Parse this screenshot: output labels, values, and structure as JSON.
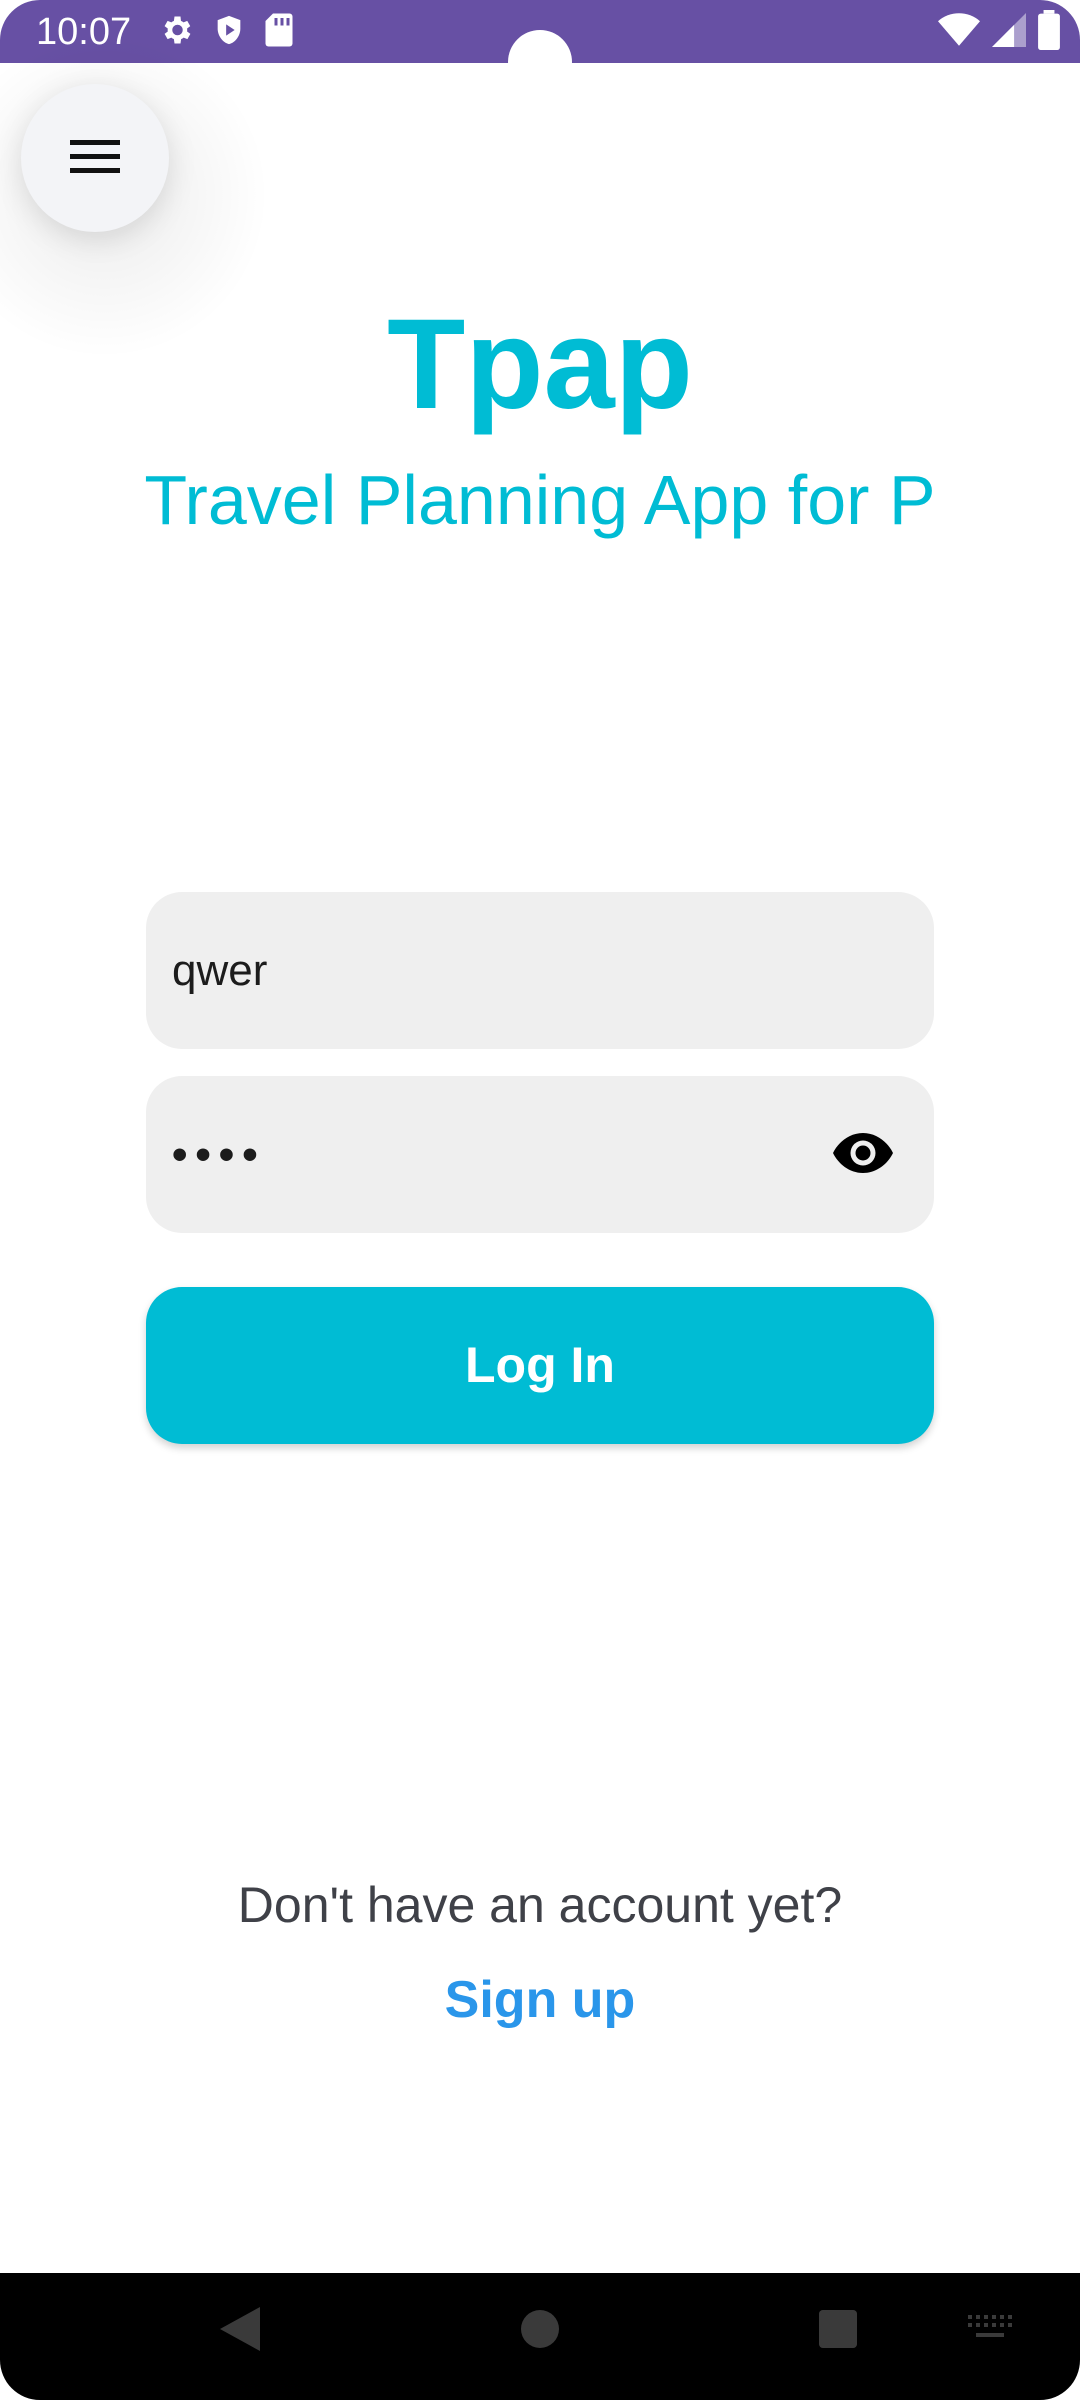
{
  "status_bar": {
    "time": "10:07",
    "background_color": "#6750a4",
    "left_icons": [
      "settings-icon",
      "shield-icon",
      "sd-card-icon"
    ],
    "right_icons": [
      "wifi-icon",
      "cellular-signal-icon",
      "battery-icon"
    ]
  },
  "menu": {
    "icon": "hamburger-menu-icon"
  },
  "header": {
    "title": "Tpap",
    "subtitle": "Travel Planning App for P",
    "accent_color": "#00bcd4"
  },
  "login_form": {
    "username_value": "qwer",
    "password_value": "••••",
    "password_toggle_icon": "eye-icon",
    "login_label": "Log In",
    "button_color": "#00bcd4"
  },
  "signup": {
    "prompt": "Don't have an account yet?",
    "link_label": "Sign up",
    "link_color": "#2a96ea"
  },
  "nav_bar": {
    "buttons": [
      "back-icon",
      "home-icon",
      "recents-icon",
      "keyboard-icon"
    ]
  }
}
